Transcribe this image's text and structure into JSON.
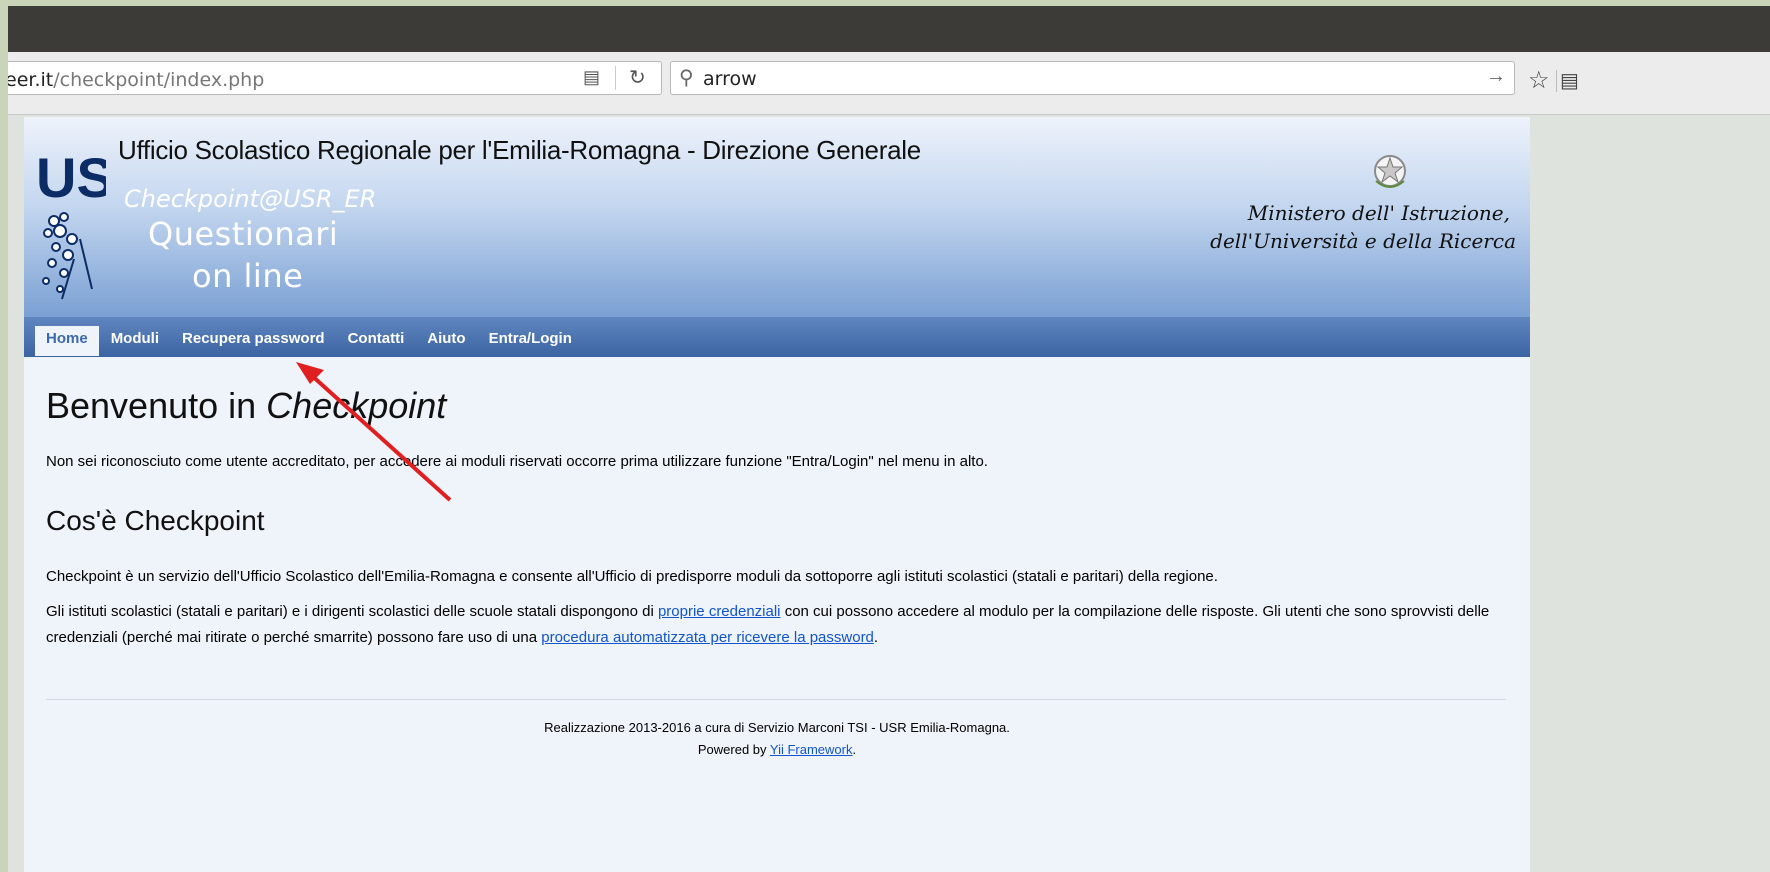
{
  "browser": {
    "url_domain": "eer.it",
    "url_path": "/checkpoint/index.php",
    "search_query": "arrow"
  },
  "site": {
    "office_title": "Ufficio Scolastico Regionale per l'Emilia-Romagna - Direzione Generale",
    "logo_text": "US",
    "checkpoint_title": "Checkpoint@USR_ER",
    "questionari_line1": "Questionari",
    "questionari_line2": "on line",
    "ministry_line1": "Ministero dell' Istruzione,",
    "ministry_line2": "dell'Università e della Ricerca"
  },
  "menu": {
    "items": [
      {
        "label": "Home",
        "active": true
      },
      {
        "label": "Moduli"
      },
      {
        "label": "Recupera password"
      },
      {
        "label": "Contatti"
      },
      {
        "label": "Aiuto"
      },
      {
        "label": "Entra/Login"
      }
    ]
  },
  "content": {
    "welcome_prefix": "Benvenuto in ",
    "welcome_emph": "Checkpoint",
    "intro": "Non sei riconosciuto come utente accreditato, per accedere ai moduli riservati occorre prima utilizzare funzione \"Entra/Login\" nel menu in alto.",
    "what_title": "Cos'è Checkpoint",
    "p1": "Checkpoint è un servizio dell'Ufficio Scolastico dell'Emilia-Romagna e consente all'Ufficio di predisporre moduli da sottoporre agli istituti scolastici (statali e paritari) della regione.",
    "p2_a": "Gli istituti scolastici (statali e paritari) e i dirigenti scolastici delle scuole statali dispongono di ",
    "p2_link1": "proprie credenziali",
    "p2_b": " con cui possono accedere al modulo per la compilazione delle risposte. Gli utenti che sono sprovvisti delle credenziali (perché mai ritirate o perché smarrite) possono fare uso di una ",
    "p2_link2": "procedura automatizzata per ricevere la password",
    "p2_c": "."
  },
  "footer": {
    "line1": "Realizzazione 2013-2016 a cura di Servizio Marconi TSI - USR Emilia-Romagna.",
    "powered_prefix": "Powered by ",
    "powered_link": "Yii Framework",
    "powered_suffix": "."
  },
  "colors": {
    "menu_bar": "#3c64a2",
    "annotation_arrow": "#e02020",
    "link": "#1155cc"
  }
}
